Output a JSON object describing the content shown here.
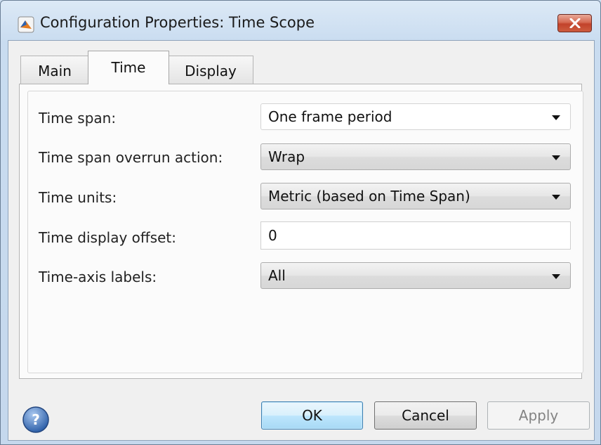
{
  "window": {
    "title": "Configuration Properties: Time Scope",
    "close_symbol": "✕"
  },
  "tabs": [
    {
      "label": "Main",
      "active": false
    },
    {
      "label": "Time",
      "active": true
    },
    {
      "label": "Display",
      "active": false
    }
  ],
  "fields": {
    "time_span": {
      "label": "Time span:",
      "value": "One frame period"
    },
    "overrun_action": {
      "label": "Time span overrun action:",
      "value": "Wrap"
    },
    "time_units": {
      "label": "Time units:",
      "value": "Metric (based on Time Span)"
    },
    "display_offset": {
      "label": "Time display offset:",
      "value": "0"
    },
    "axis_labels": {
      "label": "Time-axis labels:",
      "value": "All"
    }
  },
  "buttons": {
    "ok": "OK",
    "cancel": "Cancel",
    "apply": "Apply"
  },
  "help_symbol": "?",
  "colors": {
    "title_bar": "#c9dcf0",
    "close_button": "#c2432b",
    "default_button": "#a7d9f5",
    "help_icon": "#3a6fb8"
  }
}
